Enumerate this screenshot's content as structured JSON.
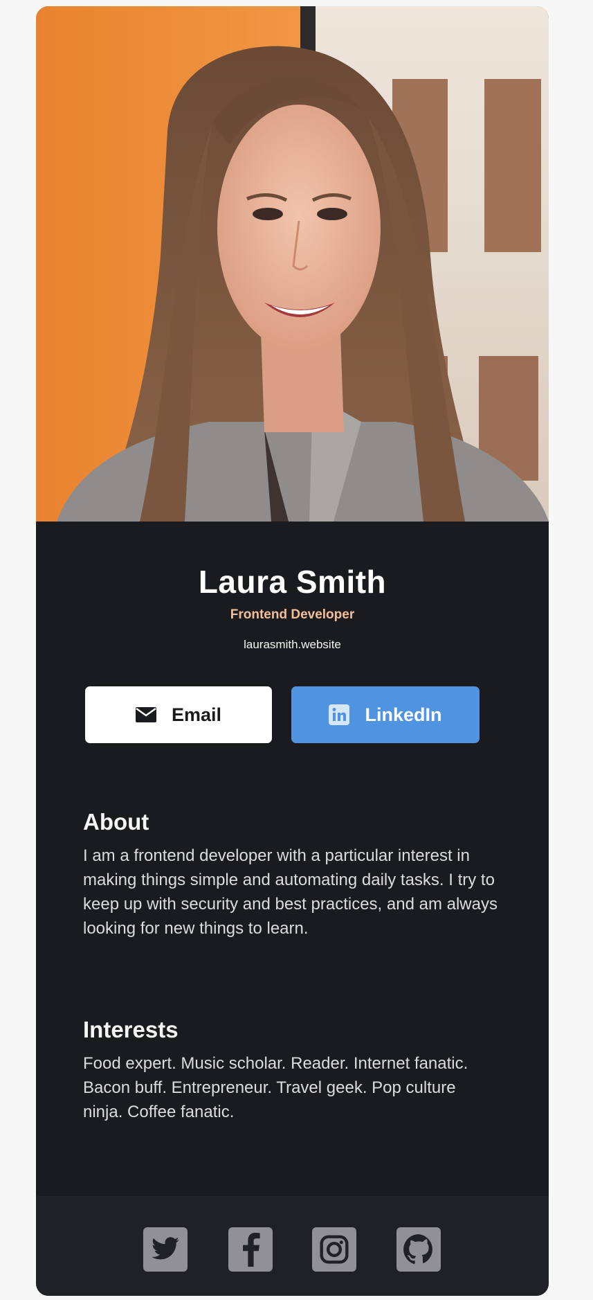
{
  "profile": {
    "name": "Laura Smith",
    "role": "Frontend Developer",
    "website": "laurasmith.website"
  },
  "buttons": {
    "email_label": "Email",
    "email_icon": "envelope-icon",
    "linkedin_label": "LinkedIn",
    "linkedin_icon": "linkedin-icon"
  },
  "about": {
    "heading": "About",
    "text": "I am a frontend developer with a particular interest in making things simple and automating daily tasks. I try to keep up with security and best practices, and am always looking for new things to learn."
  },
  "interests": {
    "heading": "Interests",
    "text": "Food expert. Music scholar. Reader. Internet fanatic. Bacon buff. Entrepreneur. Travel geek. Pop culture ninja. Coffee fanatic."
  },
  "footer": {
    "icons": [
      "twitter-icon",
      "facebook-icon",
      "instagram-icon",
      "github-icon"
    ]
  },
  "colors": {
    "card_background": "#1a1b1e",
    "footer_background": "#202125",
    "role_accent": "#f3bf99",
    "linkedin_blue": "#5093e1",
    "social_icon_gray": "#909095"
  }
}
